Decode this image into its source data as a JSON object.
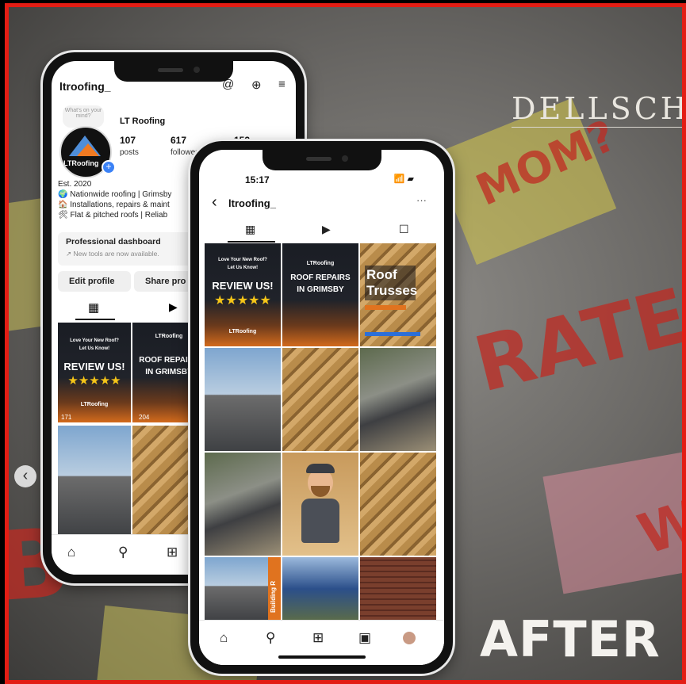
{
  "brand": {
    "name": "DELLSCHE"
  },
  "corner_label": "AFTER",
  "carousel": {
    "prev_glyph": "‹"
  },
  "profile_phone": {
    "handle": "ltroofing_",
    "note_bubble": "What's on your mind?",
    "avatar_label": "LTRoofing",
    "name": "LT Roofing",
    "stats": [
      {
        "value": "107",
        "label": "posts"
      },
      {
        "value": "617",
        "label": "followers"
      },
      {
        "value": "152",
        "label": ""
      }
    ],
    "bio": [
      "Est. 2020",
      "🌍 Nationwide roofing | Grimsby",
      "🏠 Installations, repairs & maint",
      "🛠 Flat & pitched roofs | Reliab"
    ],
    "dashboard": {
      "title": "Professional dashboard",
      "subtitle": "↗ New tools are now available."
    },
    "buttons": {
      "edit": "Edit profile",
      "share": "Share pro"
    },
    "posts": [
      {
        "line1": "Love Your New Roof?",
        "line2": "Let Us Know!",
        "headline": "REVIEW US!",
        "stars": "★★★★★",
        "tag": "LTRoofing",
        "count": "171"
      },
      {
        "line1": "LTRoofing",
        "headline": "ROOF REPAIRS IN GRIMSBY",
        "count": "204"
      }
    ]
  },
  "grid_phone": {
    "time": "15:17",
    "status_icons": "📶 ▰",
    "handle": "ltroofing_",
    "more": "···",
    "posts": [
      {
        "line1": "Love Your New Roof?",
        "line2": "Let Us Know!",
        "headline": "REVIEW US!",
        "stars": "★★★★★",
        "tag": "LTRoofing"
      },
      {
        "tag": "LTRoofing",
        "headline": "ROOF REPAIRS IN GRIMSBY"
      },
      {
        "headline": "Roof Trusses"
      }
    ],
    "side_label": "Building R"
  },
  "nav_icons": [
    "home-icon",
    "search-icon",
    "create-icon",
    "reels-icon",
    "profile-icon"
  ],
  "colors": {
    "border_red": "#e31d14",
    "accent_orange": "#d26a1c",
    "ig_blue": "#3b82f6"
  }
}
